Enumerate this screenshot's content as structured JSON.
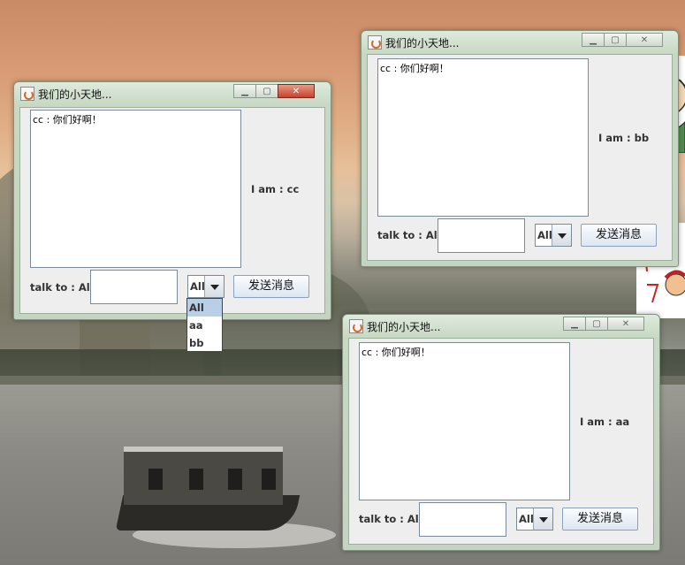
{
  "windows": {
    "cc": {
      "title": "我们的小天地...",
      "chat_text": "cc : 你们好啊！",
      "user_label": "I am : cc",
      "talk_to_label": "talk to : All",
      "target_value": "All",
      "send_button": "发送消息",
      "dropdown_options": [
        "All",
        "aa",
        "bb"
      ]
    },
    "bb": {
      "title": "我们的小天地...",
      "chat_text": "cc : 你们好啊！",
      "user_label": "I am : bb",
      "talk_to_label": "talk to : All",
      "target_value": "All",
      "send_button": "发送消息"
    },
    "aa": {
      "title": "我们的小天地...",
      "chat_text": "cc : 你们好啊！",
      "user_label": "I am : aa",
      "talk_to_label": "talk to : All",
      "target_value": "All",
      "send_button": "发送消息"
    }
  }
}
